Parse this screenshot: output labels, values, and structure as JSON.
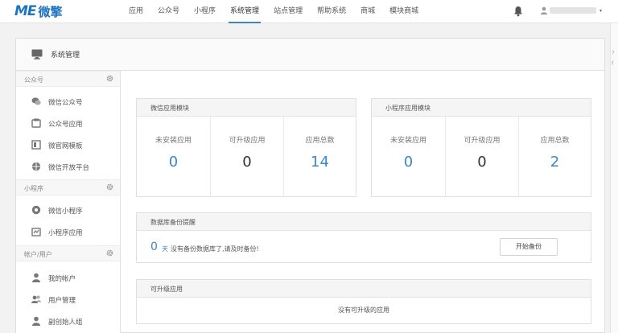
{
  "logo": {
    "mark": "ME",
    "text": "微擎"
  },
  "nav": [
    "应用",
    "公众号",
    "小程序",
    "系统管理",
    "站点管理",
    "帮助系统",
    "商城",
    "模块商城"
  ],
  "nav_active": "系统管理",
  "user": {
    "caret": "▾"
  },
  "edge_glyphs": [
    "?",
    "f"
  ],
  "panel_title": "系统管理",
  "sidebar": {
    "groups": [
      {
        "label": "公众号",
        "items": [
          {
            "label": "微信公众号",
            "icon": "wechat-icon"
          },
          {
            "label": "公众号应用",
            "icon": "app-box-icon"
          },
          {
            "label": "微官网模板",
            "icon": "template-icon"
          },
          {
            "label": "微信开放平台",
            "icon": "open-platform-icon"
          }
        ]
      },
      {
        "label": "小程序",
        "items": [
          {
            "label": "微信小程序",
            "icon": "mini-program-icon"
          },
          {
            "label": "小程序应用",
            "icon": "mini-app-icon"
          }
        ]
      },
      {
        "label": "帐户/用户",
        "items": [
          {
            "label": "我的帐户",
            "icon": "user-icon"
          },
          {
            "label": "用户管理",
            "icon": "users-icon"
          },
          {
            "label": "副创始人组",
            "icon": "founder-icon"
          }
        ]
      }
    ]
  },
  "wechat_modules": {
    "title": "微信应用模块",
    "stats": [
      {
        "label": "未安装应用",
        "value": "0"
      },
      {
        "label": "可升级应用",
        "value": "0"
      },
      {
        "label": "应用总数",
        "value": "14"
      }
    ]
  },
  "mini_modules": {
    "title": "小程序应用模块",
    "stats": [
      {
        "label": "未安装应用",
        "value": "0"
      },
      {
        "label": "可升级应用",
        "value": "0"
      },
      {
        "label": "应用总数",
        "value": "2"
      }
    ]
  },
  "backup": {
    "title": "数据库备份提醒",
    "days": "0",
    "unit": "天",
    "message": "没有备份数据库了,请及时备份!",
    "button": "开始备份"
  },
  "upgradable": {
    "title": "可升级应用",
    "empty": "没有可升级的应用"
  },
  "colors": {
    "accent": "#3a87c7",
    "logo": "#1e73be"
  }
}
